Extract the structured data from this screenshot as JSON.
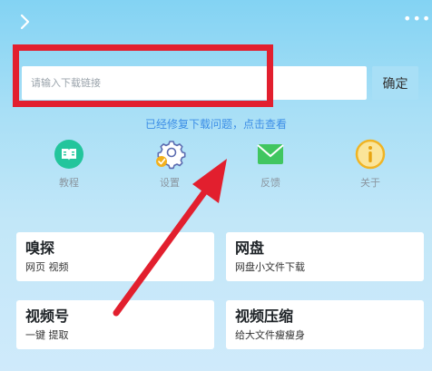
{
  "header": {
    "back_icon": "chevron-right-icon",
    "more_icon": "more-dots-icon",
    "more_text": "•••"
  },
  "search": {
    "placeholder": "请输入下载链接",
    "value": "",
    "confirm_label": "确定"
  },
  "notice": {
    "text": "已经修复下载问题，点击查看"
  },
  "shortcuts": [
    {
      "label": "教程",
      "icon": "book-icon",
      "color": "#23c59c"
    },
    {
      "label": "设置",
      "icon": "gear-icon",
      "color": "#5b6bb0"
    },
    {
      "label": "反馈",
      "icon": "mail-icon",
      "color": "#41c660"
    },
    {
      "label": "关于",
      "icon": "info-icon",
      "color": "#f0b424"
    }
  ],
  "cards": [
    {
      "title": "嗅探",
      "subtitle": "网页 视频"
    },
    {
      "title": "网盘",
      "subtitle": "网盘小文件下载"
    },
    {
      "title": "视频号",
      "subtitle": "一键 提取"
    },
    {
      "title": "视频压缩",
      "subtitle": "给大文件瘦瘦身"
    }
  ],
  "annotation": {
    "highlight_color": "#e21f2e",
    "arrow_color": "#e21f2e"
  }
}
